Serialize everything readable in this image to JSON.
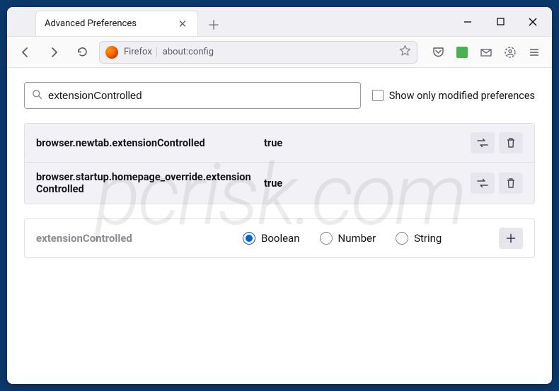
{
  "window": {
    "tab_title": "Advanced Preferences"
  },
  "toolbar": {
    "brand_label": "Firefox",
    "url": "about:config"
  },
  "search": {
    "value": "extensionControlled",
    "modified_only_label": "Show only modified preferences"
  },
  "prefs": [
    {
      "name": "browser.newtab.extensionControlled",
      "value": "true"
    },
    {
      "name": "browser.startup.homepage_override.extensionControlled",
      "value": "true"
    }
  ],
  "add": {
    "name": "extensionControlled",
    "types": [
      "Boolean",
      "Number",
      "String"
    ],
    "selected": "Boolean"
  },
  "watermark": "pcrisk.com"
}
